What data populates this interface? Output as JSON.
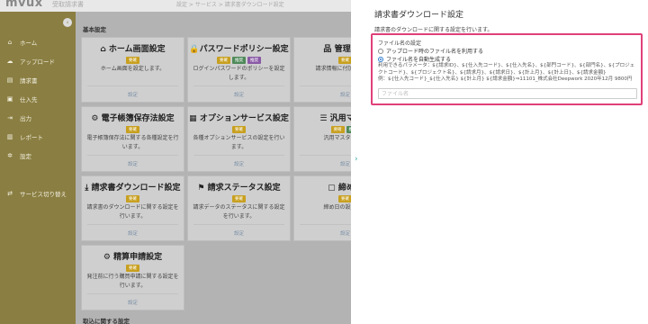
{
  "header": {
    "logo": "mvux",
    "app_name": "受取請求書",
    "breadcrumb": "設定 > サービス > 請求書ダウンロード設定"
  },
  "sidebar": {
    "collapse_icon": "chevron-left-icon",
    "items": [
      {
        "label": "ホーム",
        "icon": "home-icon"
      },
      {
        "label": "アップロード",
        "icon": "upload-icon"
      },
      {
        "label": "請求書",
        "icon": "document-icon"
      },
      {
        "label": "仕入先",
        "icon": "supplier-icon"
      },
      {
        "label": "出力",
        "icon": "export-icon"
      },
      {
        "label": "レポート",
        "icon": "report-icon"
      },
      {
        "label": "設定",
        "icon": "gear-icon"
      },
      {
        "label": "サービス切り替え",
        "icon": "switch-icon"
      }
    ]
  },
  "main": {
    "section_basic": "基本設定",
    "section_transaction": "取込に関する設定",
    "link_label": "設定",
    "cards": [
      {
        "title": "ホーム画面設定",
        "icon": "home-icon",
        "badges": [
          "要確"
        ],
        "desc": "ホーム画面を設定します。"
      },
      {
        "title": "パスワードポリシー設定",
        "icon": "lock-icon",
        "badges": [
          "要確",
          "推奨",
          "推奨"
        ],
        "desc": "ログインパスワードのポリシーを設定します。"
      },
      {
        "title": "管理項目",
        "icon": "hierarchy-icon",
        "badges": [
          "要確"
        ],
        "desc": "請求情報に付加する管理"
      },
      {
        "title": "電子帳簿保存法設定",
        "icon": "gears-icon",
        "badges": [
          "要確"
        ],
        "desc": "電子帳簿保存法に関する各種設定を行います。"
      },
      {
        "title": "オプションサービス設定",
        "icon": "grid-icon",
        "badges": [
          "要確"
        ],
        "desc": "各種オプションサービスの設定を行います。"
      },
      {
        "title": "汎用マスタ",
        "icon": "list-icon",
        "badges": [
          "要確",
          "推奨"
        ],
        "desc": "汎用マスタを設定"
      },
      {
        "title": "請求書ダウンロード設定",
        "icon": "download-icon",
        "badges": [
          "要確"
        ],
        "desc": "請求書のダウンロードに関する設定を行います。"
      },
      {
        "title": "請求ステータス設定",
        "icon": "signpost-icon",
        "badges": [
          "要確"
        ],
        "desc": "請求データのステータスに関する設定を行います。"
      },
      {
        "title": "締め日",
        "icon": "calendar-icon",
        "badges": [
          "要確"
        ],
        "desc": "締め日の設定を行"
      },
      {
        "title": "精算申請設定",
        "icon": "gears-icon",
        "badges": [
          "要確"
        ],
        "desc": "発注前に行う購買申請に関する設定を行います。"
      }
    ]
  },
  "panel": {
    "title": "請求書ダウンロード設定",
    "description": "請求書のダウンロードに関する設定を行います。",
    "field_label": "ファイル名の設定",
    "radio_options": [
      {
        "label": "アップロード時のファイル名を利用する",
        "selected": false
      },
      {
        "label": "ファイル名を自動生成する",
        "selected": true
      }
    ],
    "params_line1": "利用できるパラメータ：${請求ID}、${仕入先コード}、${仕入先名}、${部門コード}、${部門名}、${プロジェクトコード}、${プロジェクト名}、${請求月}、${請求日}、${計上月}、${計上日}、${請求金額}",
    "params_line2": "例：${仕入先コード}_${仕入先名} ${計上月} ${請求金額}⇒11101_株式会社Deepwork 2020年12月 9800円",
    "input_placeholder": "ファイル名",
    "input_value": ""
  },
  "colors": {
    "sidebar": "#8a7e42",
    "highlight_border": "#e0407a",
    "radio_active": "#2a7ad0"
  }
}
